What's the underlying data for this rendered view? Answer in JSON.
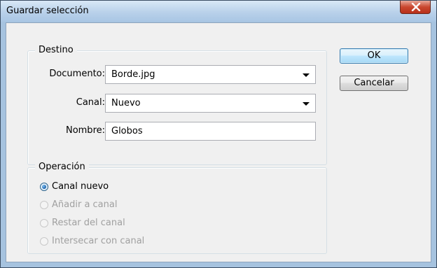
{
  "window": {
    "title": "Guardar selección",
    "close_glyph": "X"
  },
  "destino": {
    "legend": "Destino",
    "documento": {
      "label": "Documento:",
      "value": "Borde.jpg"
    },
    "canal": {
      "label": "Canal:",
      "value": "Nuevo"
    },
    "nombre": {
      "label": "Nombre:",
      "value": "Globos"
    }
  },
  "operacion": {
    "legend": "Operación",
    "options": [
      {
        "label": "Canal nuevo",
        "checked": true,
        "enabled": true
      },
      {
        "label": "Añadir a canal",
        "checked": false,
        "enabled": false
      },
      {
        "label": "Restar del canal",
        "checked": false,
        "enabled": false
      },
      {
        "label": "Intersecar con canal",
        "checked": false,
        "enabled": false
      }
    ]
  },
  "buttons": {
    "ok": "OK",
    "cancel": "Cancelar"
  },
  "colors": {
    "titlebar": "#b9d1ea",
    "close_button": "#c9472f",
    "dialog_bg": "#f0f0f0"
  }
}
